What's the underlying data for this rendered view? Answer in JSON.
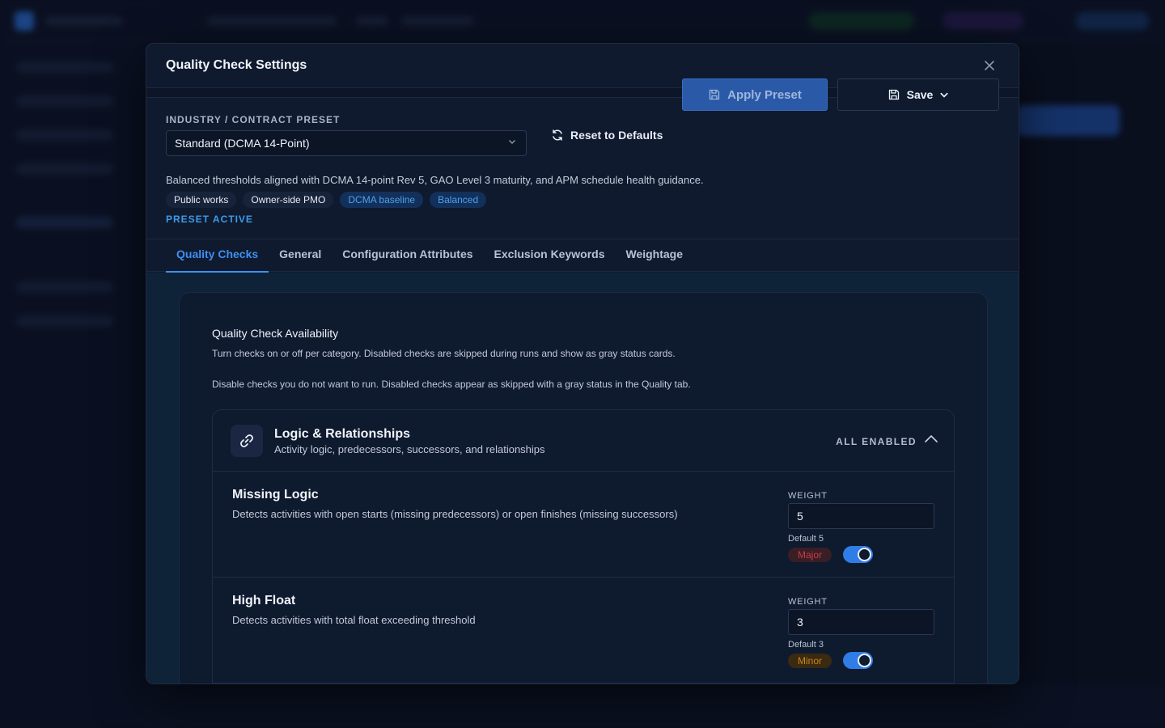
{
  "modal": {
    "title": "Quality Check Settings",
    "close_icon": "close-icon"
  },
  "preset": {
    "label": "INDUSTRY / CONTRACT PRESET",
    "selected": "Standard (DCMA 14-Point)",
    "reset_label": "Reset to Defaults",
    "apply_label": "Apply Preset",
    "save_label": "Save",
    "description": "Balanced thresholds aligned with DCMA 14-point Rev 5, GAO Level 3 maturity, and APM schedule health guidance.",
    "tags": [
      "Public works",
      "Owner-side PMO",
      "DCMA baseline",
      "Balanced"
    ],
    "status": "PRESET ACTIVE"
  },
  "tabs": [
    {
      "label": "Quality Checks",
      "active": true
    },
    {
      "label": "General",
      "active": false
    },
    {
      "label": "Configuration Attributes",
      "active": false
    },
    {
      "label": "Exclusion Keywords",
      "active": false
    },
    {
      "label": "Weightage",
      "active": false
    }
  ],
  "availability": {
    "title": "Quality Check Availability",
    "subtitle": "Turn checks on or off per category. Disabled checks are skipped during runs and show as gray status cards.",
    "note": "Disable checks you do not want to run. Disabled checks appear as skipped with a gray status in the Quality tab."
  },
  "group": {
    "icon": "link-icon",
    "title": "Logic & Relationships",
    "subtitle": "Activity logic, predecessors, successors, and relationships",
    "status": "ALL ENABLED"
  },
  "checks": [
    {
      "title": "Missing Logic",
      "description": "Detects activities with open starts (missing predecessors) or open finishes (missing successors)",
      "weight_label": "WEIGHT",
      "weight": "5",
      "default": "Default 5",
      "severity": "Major",
      "enabled": true
    },
    {
      "title": "High Float",
      "description": "Detects activities with total float exceeding threshold",
      "weight_label": "WEIGHT",
      "weight": "3",
      "default": "Default 3",
      "severity": "Minor",
      "enabled": true
    }
  ],
  "colors": {
    "accent": "#3f8ff0",
    "major": "#c93a45",
    "minor": "#c7851e"
  }
}
